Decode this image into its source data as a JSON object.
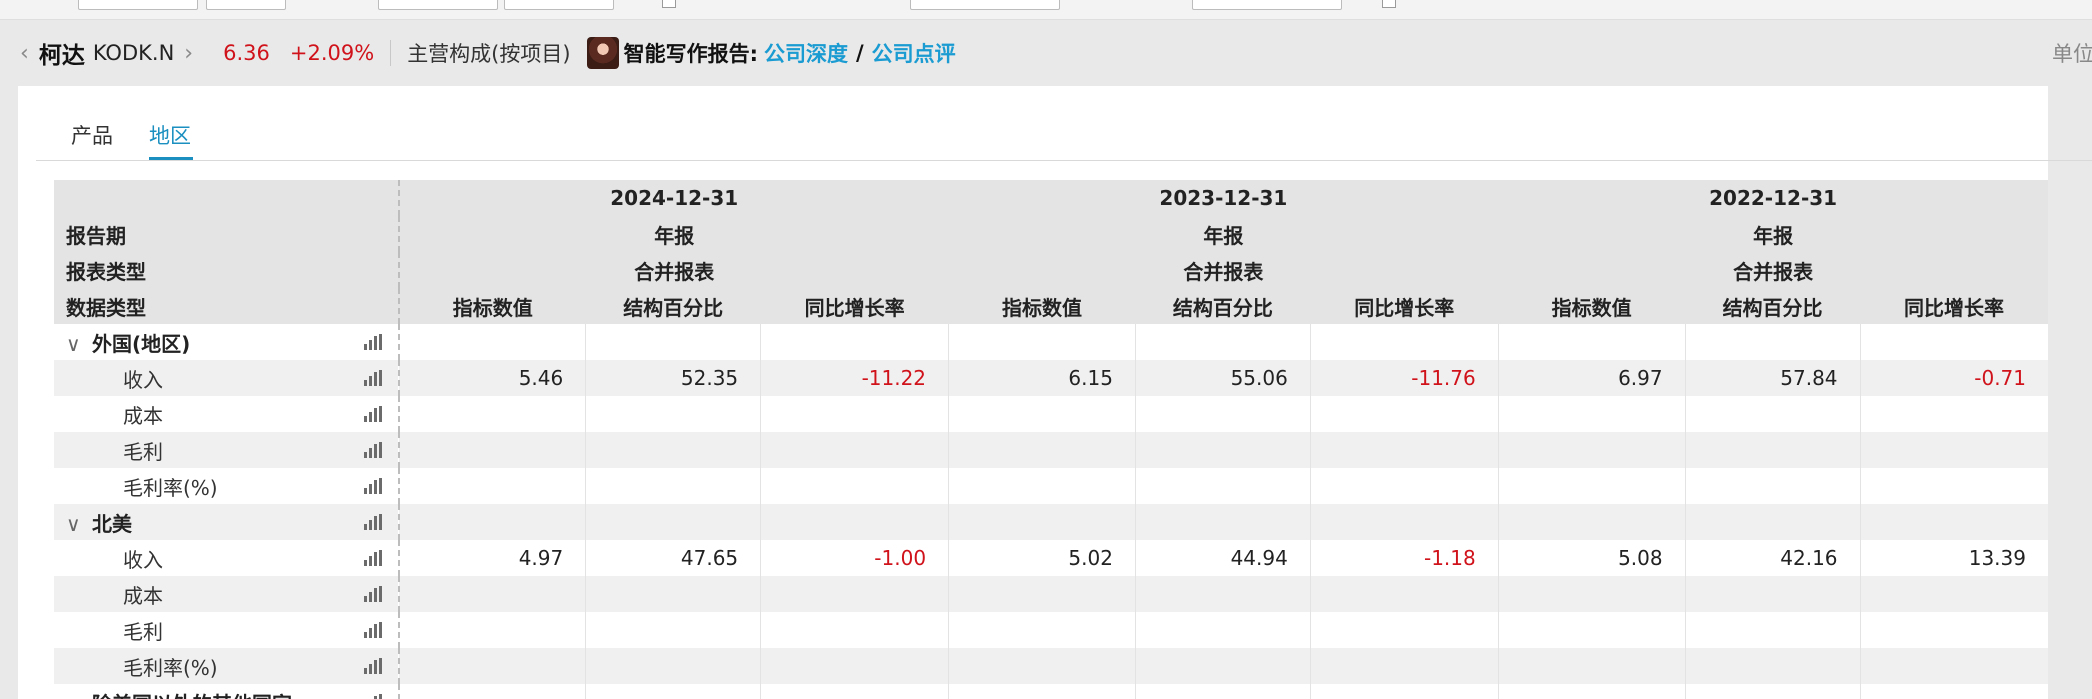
{
  "header": {
    "name": "柯达",
    "code": "KODK.N",
    "price": "6.36",
    "change": "+2.09%",
    "section": "主营构成(按项目)",
    "ai_label": "智能写作报告:",
    "link_deep": "公司深度",
    "slash": "/",
    "link_review": "公司点评",
    "unit": "单位"
  },
  "tabs": [
    {
      "label": "产品"
    },
    {
      "label": "地区"
    }
  ],
  "table": {
    "row_labels": {
      "period": "报告期",
      "report_type": "报表类型",
      "data_type": "数据类型"
    },
    "periods": [
      {
        "date": "2024-12-31",
        "type": "年报",
        "scope": "合并报表"
      },
      {
        "date": "2023-12-31",
        "type": "年报",
        "scope": "合并报表"
      },
      {
        "date": "2022-12-31",
        "type": "年报",
        "scope": "合并报表"
      }
    ],
    "columns": [
      "指标数值",
      "结构百分比",
      "同比增长率"
    ],
    "groups": [
      {
        "name": "外国(地区)",
        "rows": [
          {
            "label": "收入",
            "values": [
              "5.46",
              "52.35",
              "-11.22",
              "6.15",
              "55.06",
              "-11.76",
              "6.97",
              "57.84",
              "-0.71"
            ]
          },
          {
            "label": "成本",
            "values": [
              "",
              "",
              "",
              "",
              "",
              "",
              "",
              "",
              ""
            ]
          },
          {
            "label": "毛利",
            "values": [
              "",
              "",
              "",
              "",
              "",
              "",
              "",
              "",
              ""
            ]
          },
          {
            "label": "毛利率(%)",
            "values": [
              "",
              "",
              "",
              "",
              "",
              "",
              "",
              "",
              ""
            ]
          }
        ]
      },
      {
        "name": "北美",
        "rows": [
          {
            "label": "收入",
            "values": [
              "4.97",
              "47.65",
              "-1.00",
              "5.02",
              "44.94",
              "-1.18",
              "5.08",
              "42.16",
              "13.39"
            ]
          },
          {
            "label": "成本",
            "values": [
              "",
              "",
              "",
              "",
              "",
              "",
              "",
              "",
              ""
            ]
          },
          {
            "label": "毛利",
            "values": [
              "",
              "",
              "",
              "",
              "",
              "",
              "",
              "",
              ""
            ]
          },
          {
            "label": "毛利率(%)",
            "values": [
              "",
              "",
              "",
              "",
              "",
              "",
              "",
              "",
              ""
            ]
          }
        ]
      }
    ],
    "partial_row": "除美国以外的其他国家"
  }
}
